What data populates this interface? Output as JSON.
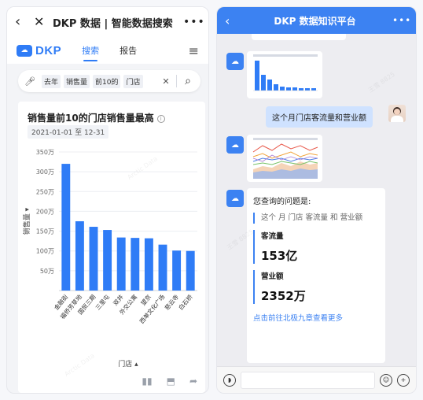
{
  "left": {
    "top_bar": {
      "back_icon": "back-arrow-icon",
      "close_icon": "close-icon",
      "title": "DKP 数据 | 智能数据搜索",
      "more_icon": "more-icon"
    },
    "nav": {
      "logo_text": "DKP",
      "tabs": [
        {
          "label": "搜索",
          "active": true
        },
        {
          "label": "报告",
          "active": false
        }
      ],
      "menu_icon": "hamburger-menu-icon"
    },
    "search": {
      "tokens": [
        "去年",
        "销售量",
        "前10的",
        "门店"
      ],
      "mic_icon": "microphone-icon",
      "clear_icon": "clear-icon",
      "search_icon": "search-icon"
    },
    "card": {
      "title": "销售量前10的门店销售量最高",
      "date_range": "2021-01-01 至 12-31",
      "tools": [
        "chart-type-icon",
        "export-icon",
        "share-icon"
      ]
    }
  },
  "chart_data": {
    "type": "bar",
    "title": "销售量前10的门店销售量最高",
    "xlabel": "门店",
    "ylabel": "销售量",
    "categories": [
      "金融街",
      "福侨芳草地",
      "国贸三期",
      "三里屯",
      "双井",
      "外交公寓",
      "望京",
      "西单文化广场",
      "慈云寺",
      "白石桥"
    ],
    "values": [
      3200000,
      1750000,
      1610000,
      1530000,
      1340000,
      1330000,
      1320000,
      1160000,
      1010000,
      1000000
    ],
    "ylim": [
      0,
      3500000
    ],
    "yticks": [
      "50万",
      "100万",
      "150万",
      "200万",
      "250万",
      "300万",
      "350万"
    ],
    "bar_color": "#2f7cf6",
    "grid": true
  },
  "right": {
    "top_bar": {
      "title": "DKP 数据知识平台",
      "back_icon": "back-arrow-icon",
      "more_icon": "more-icon"
    },
    "user_question": "这个月门店客流量和营业额",
    "answer": {
      "intro": "您查询的问题是:",
      "question_quote": "这个 月 门店 客流量 和 营业额",
      "metrics": [
        {
          "label": "客流量",
          "value": "153亿"
        },
        {
          "label": "营业额",
          "value": "2352万"
        }
      ],
      "link": "点击前往北极九章查看更多"
    },
    "input_bar": {
      "voice_icon": "voice-icon",
      "emoji_icon": "emoji-icon",
      "add_icon": "add-icon"
    }
  }
}
